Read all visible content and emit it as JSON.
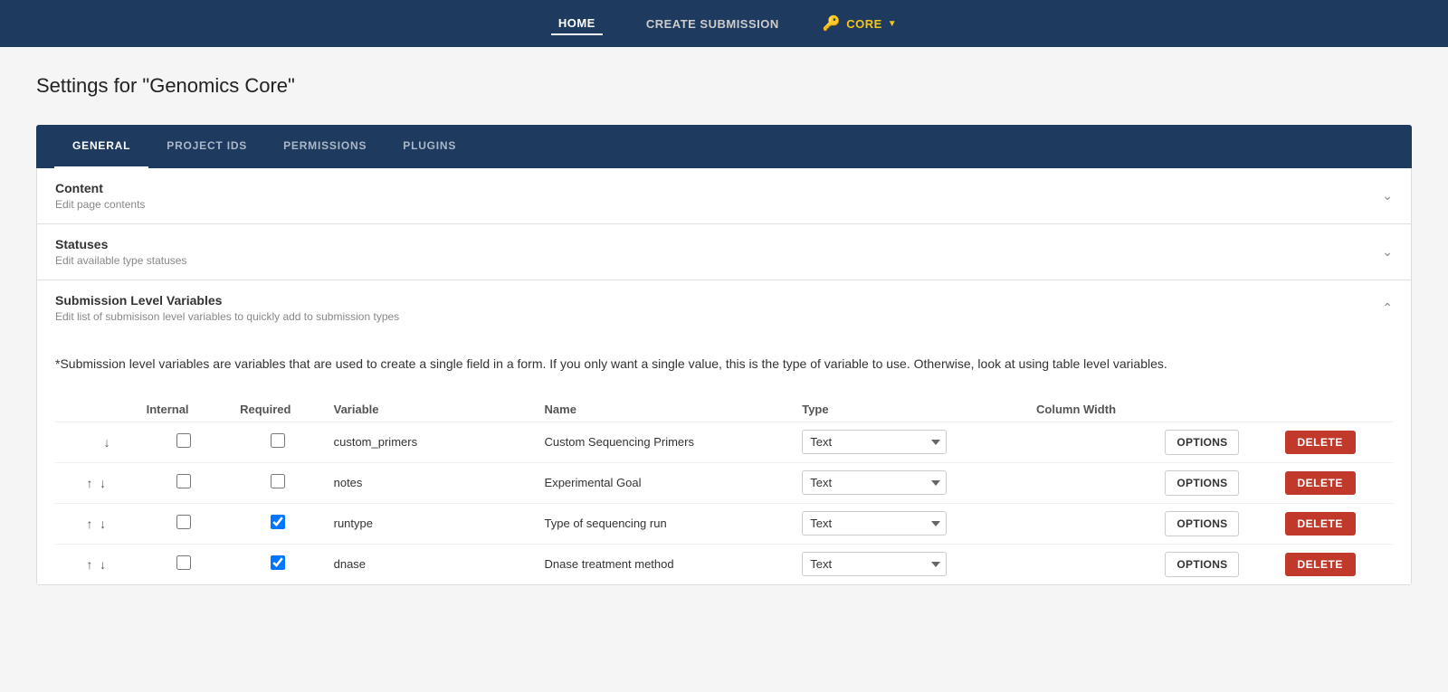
{
  "navbar": {
    "home_label": "HOME",
    "create_submission_label": "CREATE SUBMISSION",
    "core_label": "CORE"
  },
  "page": {
    "title": "Settings for \"Genomics Core\""
  },
  "tabs": [
    {
      "id": "general",
      "label": "GENERAL",
      "active": true
    },
    {
      "id": "project-ids",
      "label": "PROJECT IDS",
      "active": false
    },
    {
      "id": "permissions",
      "label": "PERMISSIONS",
      "active": false
    },
    {
      "id": "plugins",
      "label": "PLUGINS",
      "active": false
    }
  ],
  "accordion": [
    {
      "id": "content",
      "title": "Content",
      "subtitle": "Edit page contents",
      "expanded": false
    },
    {
      "id": "statuses",
      "title": "Statuses",
      "subtitle": "Edit available type statuses",
      "expanded": false
    },
    {
      "id": "submission-level-variables",
      "title": "Submission Level Variables",
      "subtitle": "Edit list of submisison level variables to quickly add to submission types",
      "expanded": true
    }
  ],
  "slv": {
    "description": "*Submission level variables are variables that are used to create a single field in a form. If you only want a single value, this is the type of variable to use. Otherwise, look at using table level variables."
  },
  "table": {
    "headers": {
      "internal": "Internal",
      "required": "Required",
      "variable": "Variable",
      "name": "Name",
      "type": "Type",
      "column_width": "Column Width"
    },
    "rows": [
      {
        "id": 1,
        "has_up": false,
        "has_down": true,
        "internal": false,
        "required": false,
        "variable": "custom_primers",
        "name": "Custom Sequencing Primers",
        "type": "Text",
        "column_width": ""
      },
      {
        "id": 2,
        "has_up": true,
        "has_down": true,
        "internal": false,
        "required": false,
        "variable": "notes",
        "name": "Experimental Goal",
        "type": "Text",
        "column_width": ""
      },
      {
        "id": 3,
        "has_up": true,
        "has_down": true,
        "internal": false,
        "required": true,
        "variable": "runtype",
        "name": "Type of sequencing run",
        "type": "Text",
        "column_width": ""
      },
      {
        "id": 4,
        "has_up": true,
        "has_down": true,
        "internal": false,
        "required": true,
        "variable": "dnase",
        "name": "Dnase treatment method",
        "type": "Text",
        "column_width": ""
      }
    ],
    "options_label": "OPTIONS",
    "delete_label": "DELETE"
  }
}
